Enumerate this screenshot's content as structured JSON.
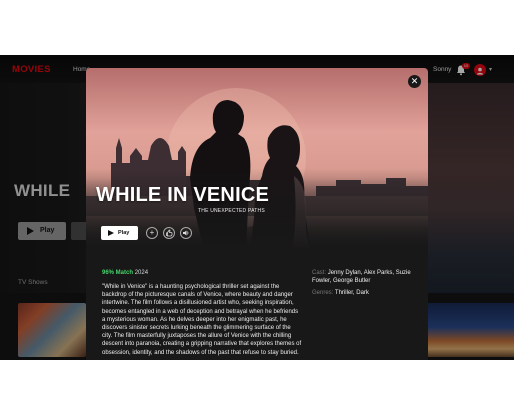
{
  "app": {
    "logo": "MOVIES",
    "nav_home": "Home",
    "user_name": "Sonny",
    "notification_count": "10"
  },
  "hero": {
    "title": "WHILE",
    "play_label": "Play"
  },
  "rows": {
    "tv_shows_label": "TV Shows"
  },
  "modal": {
    "title": "WHILE IN VENICE",
    "subtitle": "THE UNEXPECTED PATHS",
    "play_label": "Play",
    "close_icon": "close-icon",
    "match": "96% Match",
    "year": "2024",
    "description": "\"While in Venice\" is a haunting psychological thriller set against the backdrop of the picturesque canals of Venice, where beauty and danger intertwine. The film follows a disillusioned artist who, seeking inspiration, becomes entangled in a web of deception and betrayal when he befriends a mysterious woman. As he delves deeper into her enigmatic past, he discovers sinister secrets lurking beneath the glimmering surface of the city. The film masterfully juxtaposes the allure of Venice with the chilling descent into paranoia, creating a gripping narrative that explores themes of obsession, identity, and the shadows of the past that refuse to stay buried.",
    "cast_label": "Cast:",
    "cast": "Jenny Dylan, Alex Parks, Suzie Fowler, George Butler",
    "genres_label": "Genres:",
    "genres": "Thriller, Dark"
  },
  "colors": {
    "brand": "#e50914",
    "match_green": "#46d369",
    "modal_bg": "#181818"
  }
}
